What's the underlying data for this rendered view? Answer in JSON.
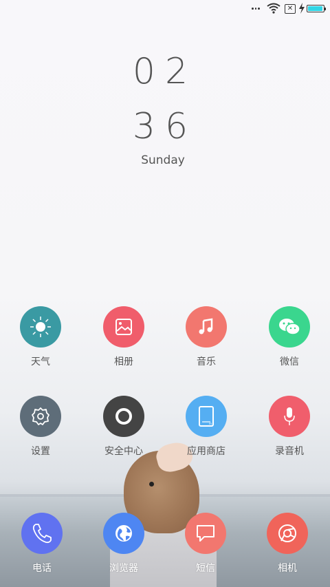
{
  "status_bar": {
    "icons": [
      "more-dots-icon",
      "wifi-icon",
      "no-sim-icon",
      "charging-bolt-icon",
      "battery-icon"
    ],
    "sim_symbol": "✕",
    "battery_level": 0.95,
    "battery_color": "#31d6e6"
  },
  "clock": {
    "hour": "02",
    "minute": "36",
    "weekday": "Sunday"
  },
  "apps": [
    {
      "label": "天气",
      "color": "#3a9aa3",
      "icon": "sun-icon"
    },
    {
      "label": "相册",
      "color": "#f05d6b",
      "icon": "gallery-icon"
    },
    {
      "label": "音乐",
      "color": "#f2776f",
      "icon": "music-note-icon"
    },
    {
      "label": "微信",
      "color": "#3ad68e",
      "icon": "wechat-icon"
    },
    {
      "label": "设置",
      "color": "#5e6d79",
      "icon": "gear-icon"
    },
    {
      "label": "安全中心",
      "color": "#444444",
      "icon": "shield-ring-icon"
    },
    {
      "label": "应用商店",
      "color": "#55aef2",
      "icon": "store-icon"
    },
    {
      "label": "录音机",
      "color": "#f05e6c",
      "icon": "microphone-icon"
    }
  ],
  "dock": [
    {
      "label": "电话",
      "color": "#6072f0",
      "icon": "phone-icon"
    },
    {
      "label": "浏览器",
      "color": "#4e86f2",
      "icon": "globe-icon"
    },
    {
      "label": "短信",
      "color": "#f2776f",
      "icon": "message-icon"
    },
    {
      "label": "相机",
      "color": "#f0645a",
      "icon": "camera-icon"
    }
  ]
}
